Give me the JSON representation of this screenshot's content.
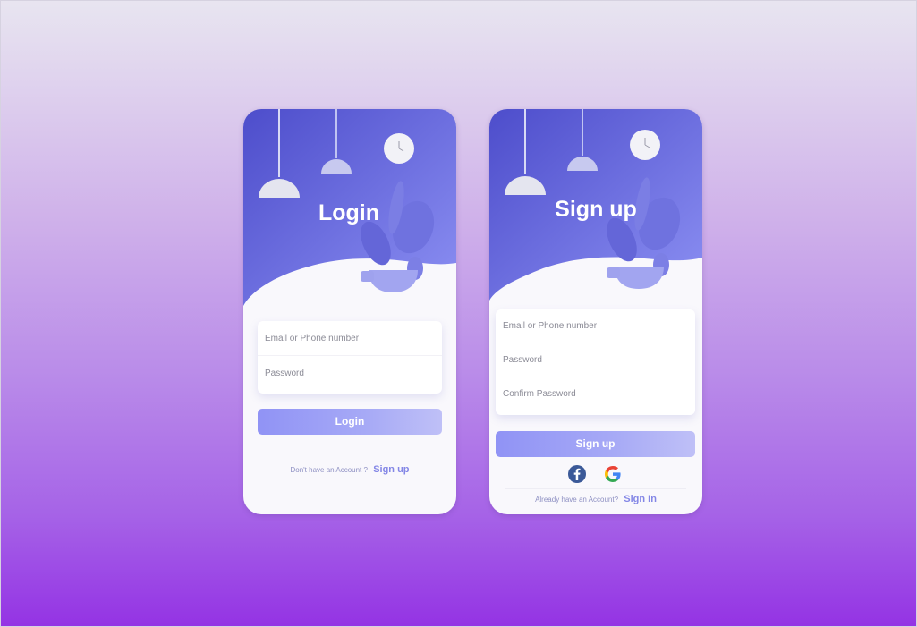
{
  "login": {
    "title": "Login",
    "email_placeholder": "Email or Phone number",
    "password_placeholder": "Password",
    "button_label": "Login",
    "footer_text": "Don't have an Account ?",
    "footer_link": "Sign up"
  },
  "signup": {
    "title": "Sign up",
    "email_placeholder": "Email or Phone number",
    "password_placeholder": "Password",
    "confirm_placeholder": "Confirm Password",
    "button_label": "Sign up",
    "social": [
      {
        "icon": "facebook-icon"
      },
      {
        "icon": "google-icon"
      }
    ],
    "footer_text": "Already have an Account?",
    "footer_link": "Sign In"
  },
  "colors": {
    "hero_start": "#4f4fcf",
    "hero_end": "#8a8ef1",
    "button": "#a7aaf6",
    "facebook": "#3b5998"
  }
}
